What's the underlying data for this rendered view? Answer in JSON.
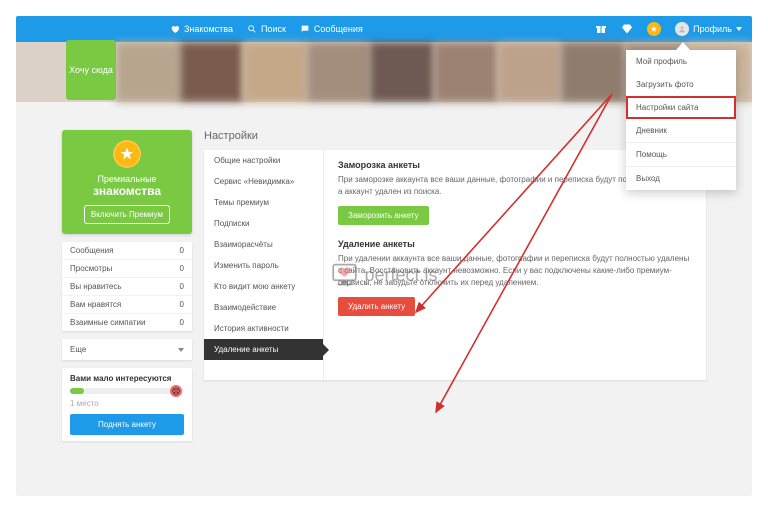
{
  "nav": {
    "dating": "Знакомства",
    "search": "Поиск",
    "messages": "Сообщения",
    "profile": "Профиль"
  },
  "want_here": "Хочу сюда",
  "dropdown": {
    "my_profile": "Мой профиль",
    "upload_photo": "Загрузить фото",
    "site_settings": "Настройки сайта",
    "diary": "Дневник",
    "help": "Помощь",
    "logout": "Выход"
  },
  "premium": {
    "line1": "Премиальные",
    "line2": "знакомства",
    "button": "Включить Премиум"
  },
  "stats": [
    {
      "label": "Сообщения",
      "value": "0"
    },
    {
      "label": "Просмотры",
      "value": "0"
    },
    {
      "label": "Вы нравитесь",
      "value": "0"
    },
    {
      "label": "Вам нравятся",
      "value": "0"
    },
    {
      "label": "Взаимные симпатии",
      "value": "0"
    }
  ],
  "more": "Еще",
  "interest": {
    "title": "Вами мало интересуются",
    "place": "1 место",
    "button": "Поднять анкету"
  },
  "settings": {
    "title": "Настройки",
    "nav": [
      "Общие настройки",
      "Сервис «Невидимка»",
      "Темы премиум",
      "Подписки",
      "Взаиморасчёты",
      "Изменить пароль",
      "Кто видит мою анкету",
      "Взаимодействие",
      "История активности",
      "Удаление анкеты"
    ],
    "freeze": {
      "title": "Заморозка анкеты",
      "text": "При заморозке аккаунта все ваши данные, фотографии и переписка будут полностью скрыты, а аккаунт удален из поиска.",
      "button": "Заморозить анкету"
    },
    "delete": {
      "title": "Удаление анкеты",
      "text": "При удалении аккаунта все ваши данные, фотографии и переписка будут полностью удалены с сайта. Восстановить аккаунт невозможно. Если у вас подключены какие-либо премиум-сервисы, не забудьте отключить их перед удалением.",
      "button": "Удалить анкету"
    }
  },
  "watermark": "perfect.is",
  "blur_colors": [
    "#b7a68e",
    "#7a5c4e",
    "#c4a989",
    "#a38d7c",
    "#6e5a52",
    "#9c8272",
    "#bda28b",
    "#8e7c6c",
    "#a79384",
    "#c9b59c"
  ]
}
